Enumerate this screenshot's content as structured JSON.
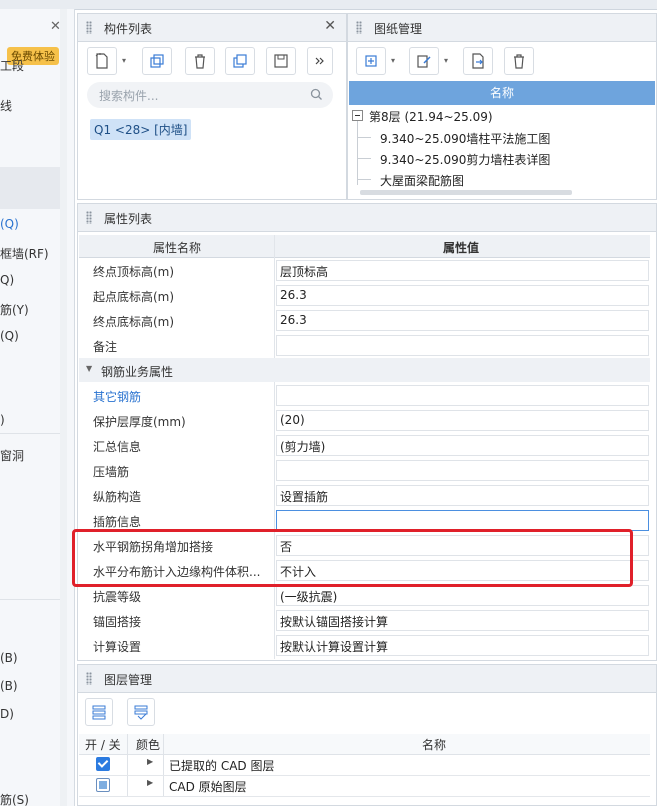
{
  "left_panel": {
    "badge": "免费体验",
    "items": [
      "工段",
      "线",
      "(Q)",
      "框墙(RF)",
      "Q)",
      "筋(Y)",
      "(Q)",
      ")",
      "窗洞",
      "(B)",
      "(B)",
      "D)",
      "筋(S)"
    ]
  },
  "component_list": {
    "title": "构件列表",
    "search_placeholder": "搜索构件...",
    "selected_item": "Q1 <28> [内墙]"
  },
  "drawing_mgmt": {
    "title": "图纸管理",
    "column_name": "名称",
    "floor": "第8层 (21.94~25.09)",
    "drawings": [
      "9.340~25.090墙柱平法施工图",
      "9.340~25.090剪力墙柱表详图",
      "大屋面梁配筋图"
    ]
  },
  "property_list": {
    "title": "属性列表",
    "col_name": "属性名称",
    "col_value": "属性值",
    "rows_top": [
      {
        "name": "终点顶标高(m)",
        "value": "层顶标高"
      },
      {
        "name": "起点底标高(m)",
        "value": "26.3"
      },
      {
        "name": "终点底标高(m)",
        "value": "26.3"
      },
      {
        "name": "备注",
        "value": ""
      }
    ],
    "section": "钢筋业务属性",
    "rows_bottom": [
      {
        "name": "其它钢筋",
        "value": ""
      },
      {
        "name": "保护层厚度(mm)",
        "value": "(20)"
      },
      {
        "name": "汇总信息",
        "value": "(剪力墙)"
      },
      {
        "name": "压墙筋",
        "value": ""
      },
      {
        "name": "纵筋构造",
        "value": "设置插筋"
      },
      {
        "name": "插筋信息",
        "value": ""
      },
      {
        "name": "水平钢筋拐角增加搭接",
        "value": "否"
      },
      {
        "name": "水平分布筋计入边缘构件体积...",
        "value": "不计入"
      },
      {
        "name": "抗震等级",
        "value": "(一级抗震)"
      },
      {
        "name": "锚固搭接",
        "value": "按默认锚固搭接计算"
      },
      {
        "name": "计算设置",
        "value": "按默认计算设置计算"
      }
    ]
  },
  "layer_mgmt": {
    "title": "图层管理",
    "col_toggle": "开 / 关",
    "col_color": "颜色",
    "col_name": "名称",
    "rows": [
      {
        "name": "已提取的 CAD 图层",
        "checked": true
      },
      {
        "name": "CAD 原始图层",
        "checked": false
      }
    ]
  },
  "colors": {
    "accent": "#6ea4dd",
    "highlight": "#e0202a",
    "link": "#2a73d0"
  }
}
